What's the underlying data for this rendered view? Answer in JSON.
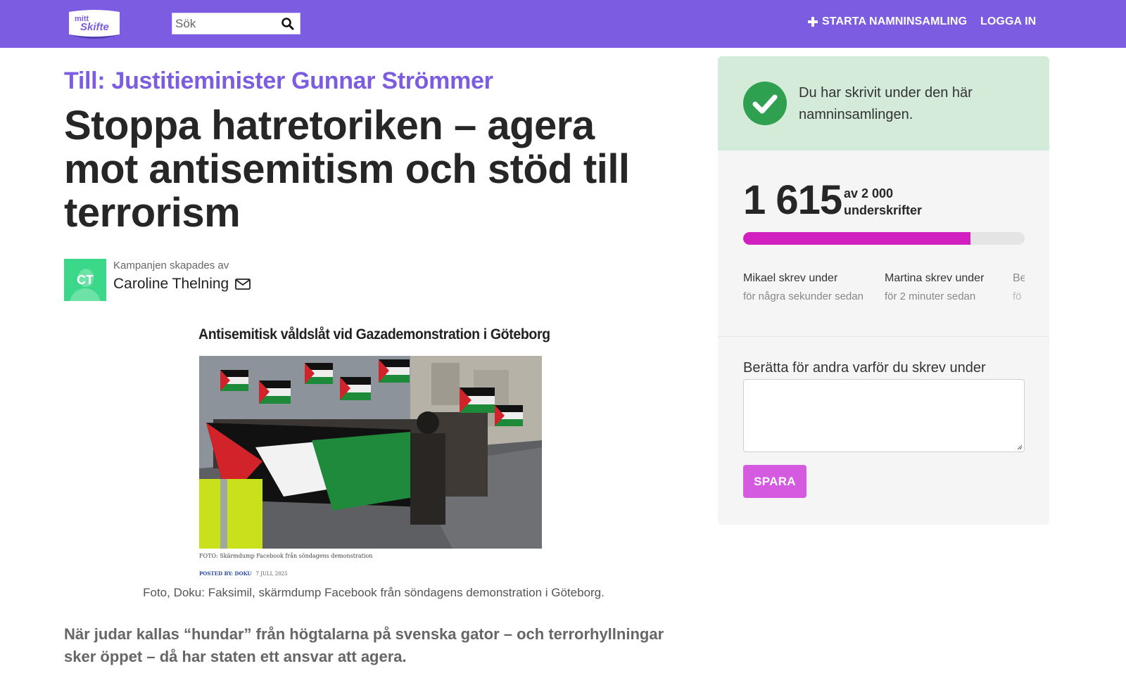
{
  "header": {
    "logo_text_line1": "mitt",
    "logo_text_line2": "Skifte",
    "search_placeholder": "Sök",
    "start_label": "STARTA NAMNINSAMLING",
    "login_label": "LOGGA IN"
  },
  "petition": {
    "recipient": "Till: Justitieminister Gunnar Strömmer",
    "title": "Stoppa hatretoriken – agera mot antisemitism och stöd till terrorism",
    "creator_label": "Kampanjen skapades av",
    "creator_name": "Caroline Thelning",
    "creator_initials": "CT",
    "figure": {
      "headline": "Antisemitisk våldslåt vid Gazademonstration i Göteborg",
      "image_caption": "FOTO: Skärmdump Facebook från söndagens demonstration",
      "posted_by": "POSTED BY: DOKU",
      "posted_date": "7 JULI, 2025"
    },
    "photo_caption": "Foto, Doku: Faksimil, skärmdump Facebook från söndagens demonstration i Göteborg.",
    "lead": "När judar kallas “hundar” från högtalarna på svenska gator – och terrorhyllningar sker öppet – då har staten ett ansvar att agera."
  },
  "sidebar": {
    "signed_message": "Du har skrivit under den här namninsamlingen.",
    "count": "1 615",
    "goal_line1": "av 2 000",
    "goal_line2": "underskrifter",
    "progress_fraction": 0.8075,
    "recent": [
      {
        "name": "Mikael skrev under",
        "time": "för några sekunder sedan"
      },
      {
        "name": "Martina skrev under",
        "time": "för 2 minuter sedan"
      },
      {
        "name": "Be",
        "time": "fö"
      }
    ],
    "why_label": "Berätta för andra varför du skrev under",
    "why_value": "",
    "save_label": "SPARA"
  },
  "colors": {
    "brand_purple": "#7c5ce0",
    "progress_magenta": "#d21fbf",
    "success_green": "#2fa04f",
    "save_button": "#d45ae0",
    "avatar_green": "#3bd889"
  }
}
